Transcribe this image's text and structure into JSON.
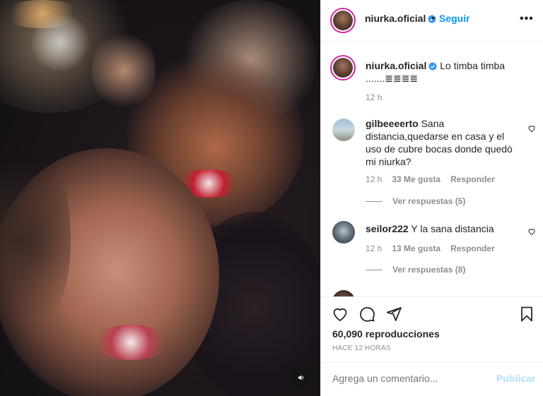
{
  "colors": {
    "accent": "#0095f6",
    "accent_disabled": "#b2dffc",
    "muted": "#8e8e8e",
    "text": "#262626",
    "ring": "#d6249f"
  },
  "header": {
    "username": "niurka.oficial",
    "separator": "•",
    "follow_label": "Seguir",
    "more_icon": "more-options-icon",
    "more_label": "•••"
  },
  "caption": {
    "username": "niurka.oficial",
    "text": "Lo timba timba .......≣≣≣≣",
    "time": "12 h"
  },
  "comments": [
    {
      "username": "gilbeeeerto",
      "text": "Sana distancia,quedarse en casa y el uso de cubre bocas donde quedó mi niurka?",
      "time": "12 h",
      "likes": "33 Me gusta",
      "reply_label": "Responder",
      "replies_label": "Ver respuestas (5)"
    },
    {
      "username": "seilor222",
      "text": "Y la sana distancia",
      "time": "12 h",
      "likes": "13 Me gusta",
      "reply_label": "Responder",
      "replies_label": "Ver respuestas (8)"
    }
  ],
  "actions": {
    "views": "60,090 reproducciones",
    "time_ago": "HACE 12 HORAS"
  },
  "add_comment": {
    "placeholder": "Agrega un comentario...",
    "post_label": "Publicar"
  }
}
